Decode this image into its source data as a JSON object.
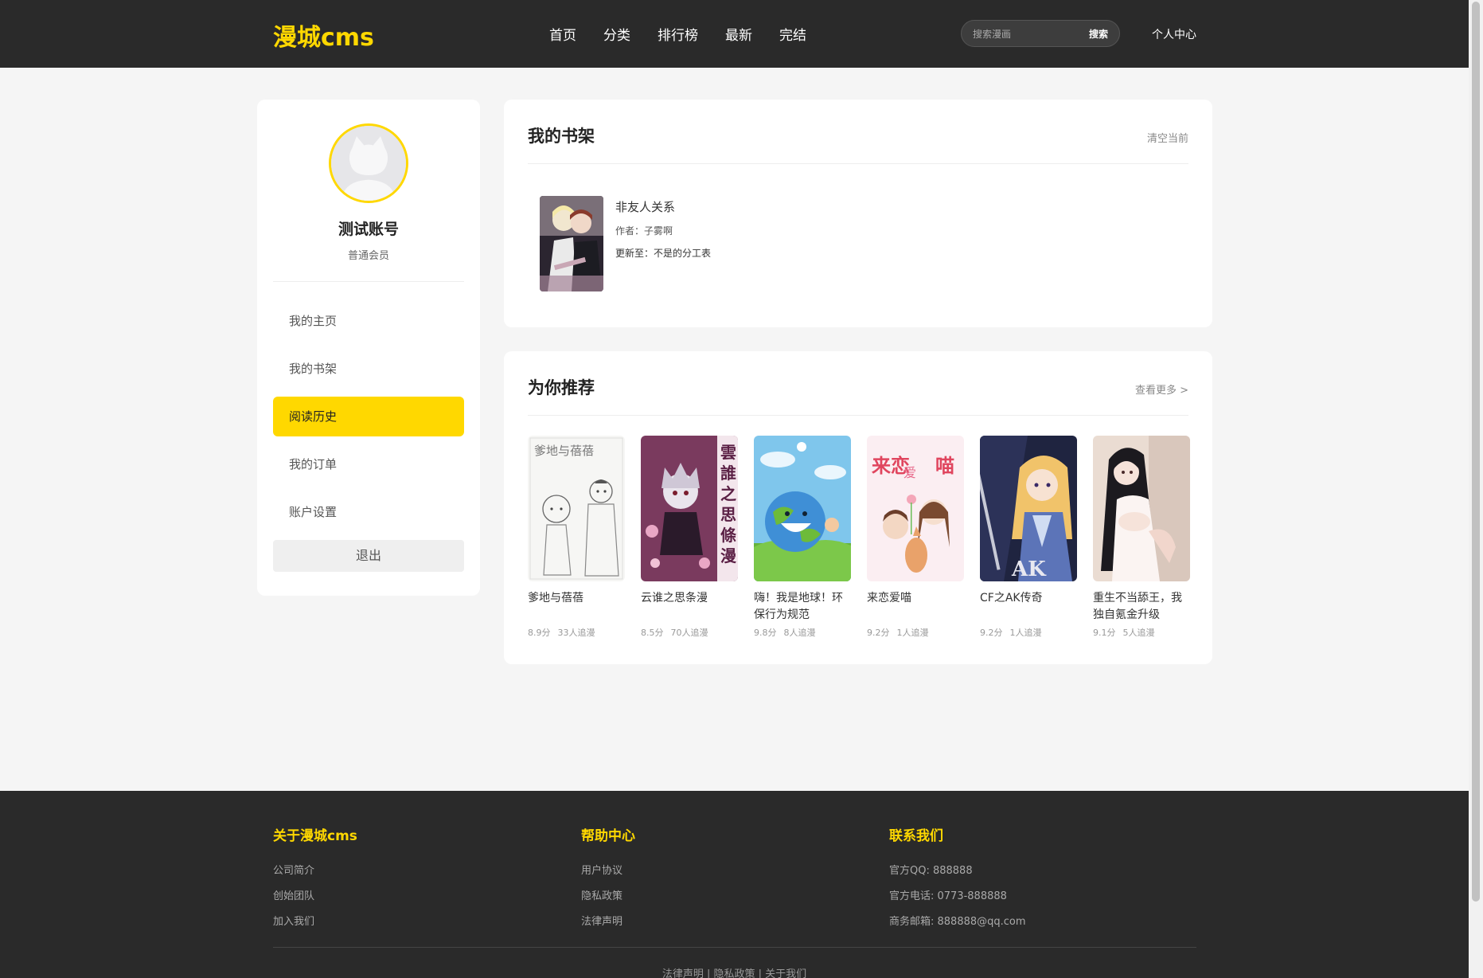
{
  "header": {
    "logo": "漫城cms",
    "nav": [
      "首页",
      "分类",
      "排行榜",
      "最新",
      "完结"
    ],
    "search_placeholder": "搜索漫画",
    "search_button": "搜索",
    "user_center": "个人中心"
  },
  "sidebar": {
    "username": "测试账号",
    "level": "普通会员",
    "menu": [
      "我的主页",
      "我的书架",
      "阅读历史",
      "我的订单",
      "账户设置"
    ],
    "active_index": 2,
    "logout": "退出"
  },
  "shelf": {
    "title": "我的书架",
    "action": "清空当前",
    "item": {
      "title": "非友人关系",
      "author": "作者：子雾啊",
      "update": "更新至：不是的分工表"
    }
  },
  "recommend": {
    "title": "为你推荐",
    "more": "查看更多 >",
    "items": [
      {
        "name": "爹地与蓓蓓",
        "score": "8.9分",
        "follow": "33人追漫"
      },
      {
        "name": "云谁之思条漫",
        "score": "8.5分",
        "follow": "70人追漫"
      },
      {
        "name": "嗨！我是地球！环保行为规范",
        "score": "9.8分",
        "follow": "8人追漫"
      },
      {
        "name": "来恋爱喵",
        "score": "9.2分",
        "follow": "1人追漫"
      },
      {
        "name": "CF之AK传奇",
        "score": "9.2分",
        "follow": "1人追漫"
      },
      {
        "name": "重生不当舔王，我独自氪金升级",
        "score": "9.1分",
        "follow": "5人追漫"
      }
    ]
  },
  "footer": {
    "columns": [
      {
        "title": "关于漫城cms",
        "links": [
          "公司简介",
          "创始团队",
          "加入我们"
        ]
      },
      {
        "title": "帮助中心",
        "links": [
          "用户协议",
          "隐私政策",
          "法律声明"
        ]
      },
      {
        "title": "联系我们",
        "links": [
          "官方QQ: 888888",
          "官方电话: 0773-888888",
          "商务邮箱: 888888@qq.com"
        ]
      }
    ],
    "bottom": "法律声明 | 隐私政策 | 关于我们"
  },
  "colors": {
    "accent": "#ffd800",
    "header_bg": "#2a2a2a"
  }
}
